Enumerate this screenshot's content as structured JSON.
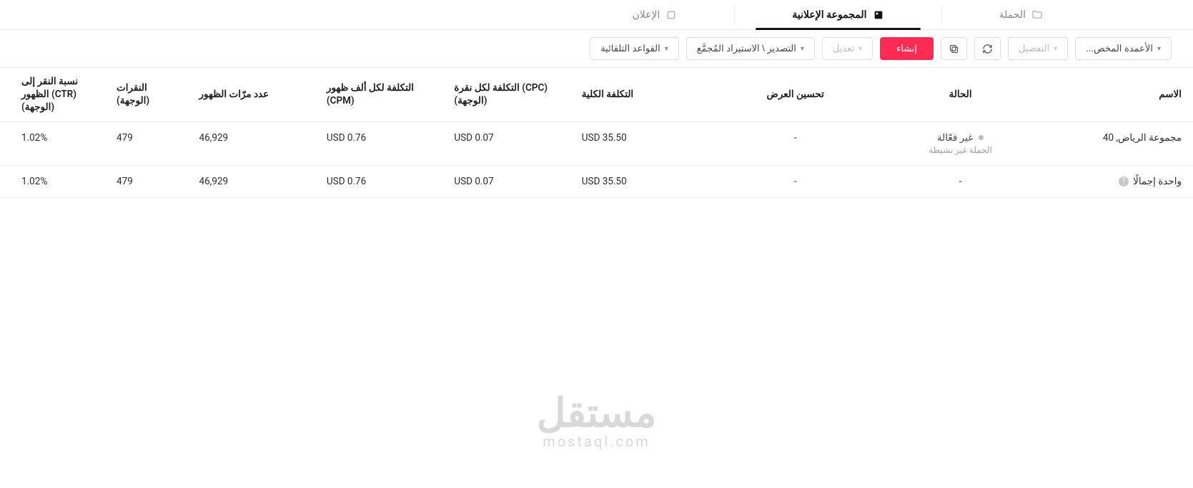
{
  "tabs": {
    "campaign": "الحملة",
    "adgroup": "المجموعة الإعلانية",
    "ad": "الإعلان"
  },
  "toolbar": {
    "custom_columns": "الأعمدة المخص...",
    "breakdown": "التفصيل",
    "edit": "تعديل",
    "create": "إنشاء",
    "export": "التصدير \\ الاستيراد المُجمَّع",
    "rules": "القواعد التلقائية"
  },
  "columns": {
    "name": "الاسم",
    "status": "الحالة",
    "optimization": "تحسين العرض",
    "total_cost": "التكلفة الكلية",
    "cpc": "التكلفة لكل نقرة (CPC) (الوجهة)",
    "cpm": "التكلفة لكل ألف ظهور (CPM)",
    "impressions": "عدد مرّات الظهور",
    "clicks": "النقرات (الوجهة)",
    "ctr": "نسبة النقر إلى الظهور (CTR) (الوجهة)"
  },
  "rows": [
    {
      "name": "مجموعة الرياض, 40",
      "status": "غير فعّالة",
      "status_sub": "الحملة غير نشيطة",
      "optimization": "-",
      "total_cost": "USD 35.50",
      "cpc": "USD 0.07",
      "cpm": "USD 0.76",
      "impressions": "46,929",
      "clicks": "479",
      "ctr": "1.02%"
    }
  ],
  "totals": {
    "label": "واحدة إجمالًا",
    "status": "-",
    "optimization": "-",
    "total_cost": "USD 35.50",
    "cpc": "USD 0.07",
    "cpm": "USD 0.76",
    "impressions": "46,929",
    "clicks": "479",
    "ctr": "1.02%"
  },
  "watermark": {
    "ar": "مستقل",
    "en": "mostaql.com"
  }
}
